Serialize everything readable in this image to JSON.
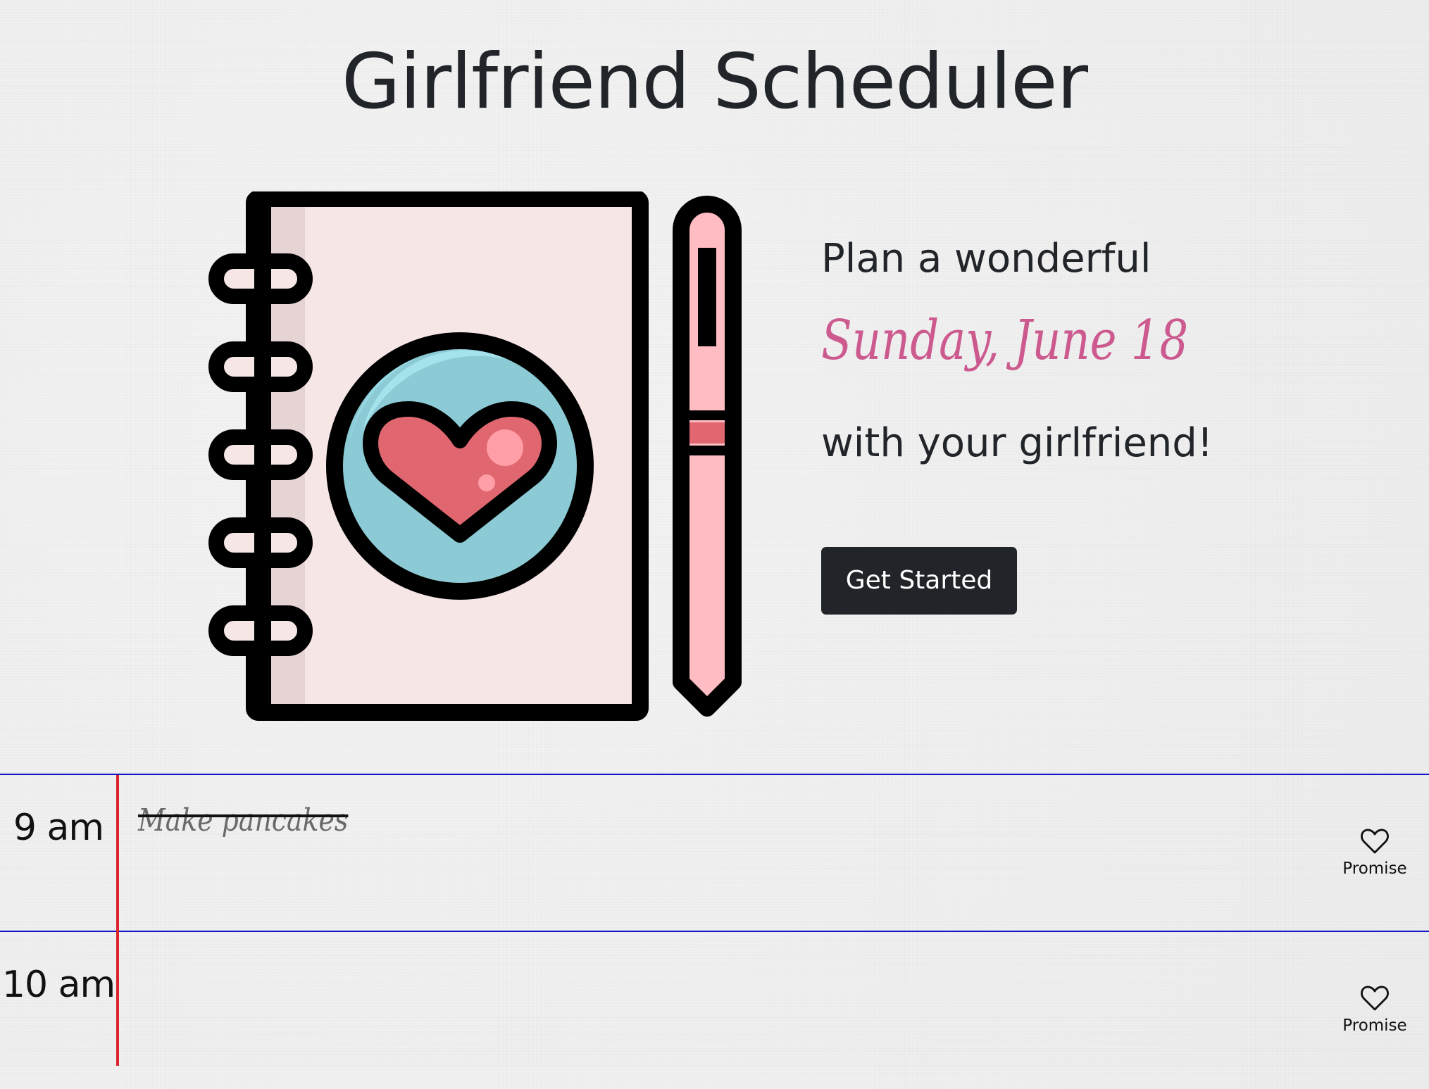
{
  "header": {
    "title": "Girlfriend Scheduler"
  },
  "hero": {
    "illustration_icon": "notebook-with-heart-and-pen",
    "plan_text": "Plan a wonderful",
    "date_text": "Sunday, June 18",
    "with_text": "with your girlfriend!",
    "cta_label": "Get Started"
  },
  "planner": {
    "rows": [
      {
        "hour": "9 am",
        "event": "Make pancakes",
        "event_completed": true,
        "promise_label": "Promise",
        "promise_icon": "heart-outline-icon"
      },
      {
        "hour": "10 am",
        "event": "",
        "event_completed": false,
        "promise_label": "Promise",
        "promise_icon": "heart-outline-icon"
      }
    ]
  },
  "colors": {
    "background": "#efefef",
    "text": "#212529",
    "date_accent": "#cc5a8f",
    "button_bg": "#212529",
    "button_text": "#ffffff",
    "row_rule": "#1515c8",
    "margin_rule": "#d9242c",
    "notebook_cover": "#f7e6e6",
    "notebook_spine": "#e6d3d3",
    "badge_blue": "#8ccbd5",
    "heart_red": "#e0666f",
    "pen_pink": "#ffbcc2"
  }
}
